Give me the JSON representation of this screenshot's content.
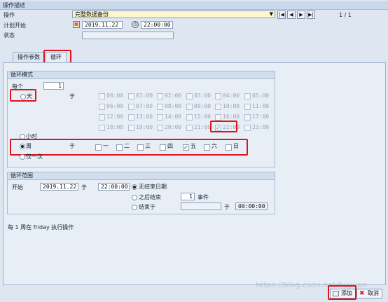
{
  "header": {
    "title": "操作描述"
  },
  "op": {
    "label": "操作",
    "value": "完整数据备份",
    "page": "1 / 1"
  },
  "plan": {
    "label": "计划开始",
    "date": "2019.11.22",
    "time": "22:00:00"
  },
  "status": {
    "label": "状态",
    "value": ""
  },
  "tabs": [
    {
      "label": "操作参数"
    },
    {
      "label": "循环"
    }
  ],
  "cycle": {
    "title": "循环模式",
    "every_label": "每个",
    "every_value": "1",
    "at_label": "于",
    "day_label": "天",
    "hour_label": "小时",
    "week_label": "周",
    "once_label": "仅一次",
    "hours": [
      "00:00",
      "01:00",
      "02:00",
      "03:00",
      "04:00",
      "05:00",
      "06:00",
      "07:00",
      "08:00",
      "09:00",
      "10:00",
      "11:00",
      "12:00",
      "13:00",
      "14:00",
      "15:00",
      "16:00",
      "17:00",
      "18:00",
      "19:00",
      "20:00",
      "21:00",
      "22:00",
      "23:00"
    ],
    "weekdays": [
      {
        "label": "一",
        "checked": false
      },
      {
        "label": "二",
        "checked": false
      },
      {
        "label": "三",
        "checked": false
      },
      {
        "label": "四",
        "checked": false
      },
      {
        "label": "五",
        "checked": true
      },
      {
        "label": "六",
        "checked": false
      },
      {
        "label": "日",
        "checked": false
      }
    ]
  },
  "range": {
    "title": "循环范围",
    "start_label": "开始",
    "start_date": "2019.11.22",
    "at_label": "于",
    "start_time": "22:00:00",
    "no_end": "无结束日期",
    "after_end": "之后结束",
    "count": "1",
    "event_label": "事件",
    "end_on": "结束于",
    "end_at_label": "于",
    "end_time": "00:00:00"
  },
  "summary": "每 1 周在 friday 执行操作",
  "buttons": {
    "add": "添加",
    "cancel": "取消"
  },
  "watermark": "https://blog.csdn.net/huyuan"
}
